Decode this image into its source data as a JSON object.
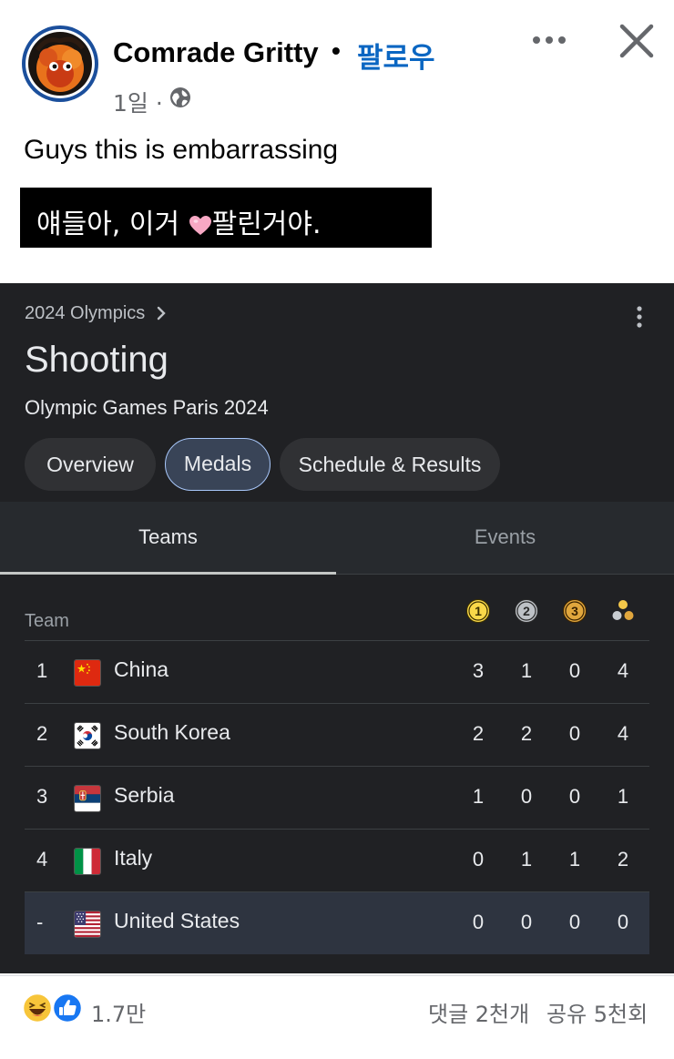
{
  "post": {
    "author": "Comrade Gritty",
    "separator": "•",
    "follow_label": "팔로우",
    "time": "1일 ·",
    "privacy_icon": "globe-icon",
    "text": "Guys this is embarrassing",
    "translation_before": "얘들아, 이거 ",
    "translation_after": "팔린거야.",
    "translation_emoji": "pink-heart-icon"
  },
  "card": {
    "breadcrumb": "2024 Olympics",
    "title": "Shooting",
    "subtitle": "Olympic Games Paris 2024",
    "chips": [
      {
        "label": "Overview",
        "active": false
      },
      {
        "label": "Medals",
        "active": true
      },
      {
        "label": "Schedule & Results",
        "active": false
      }
    ],
    "tabs": [
      {
        "label": "Teams",
        "selected": true
      },
      {
        "label": "Events",
        "selected": false
      }
    ],
    "table": {
      "team_header": "Team",
      "medal_headers": [
        {
          "icon": "gold-medal-icon",
          "label": "1",
          "color": "#f9d849"
        },
        {
          "icon": "silver-medal-icon",
          "label": "2",
          "color": "#bdc1c6"
        },
        {
          "icon": "bronze-medal-icon",
          "label": "3",
          "color": "#e0a63d"
        },
        {
          "icon": "total-medals-icon",
          "color": "#f4c84a"
        }
      ],
      "rows": [
        {
          "rank": "1",
          "team": "China",
          "flag": "china-flag-icon",
          "gold": "3",
          "silver": "1",
          "bronze": "0",
          "total": "4"
        },
        {
          "rank": "2",
          "team": "South Korea",
          "flag": "south-korea-flag-icon",
          "gold": "2",
          "silver": "2",
          "bronze": "0",
          "total": "4"
        },
        {
          "rank": "3",
          "team": "Serbia",
          "flag": "serbia-flag-icon",
          "gold": "1",
          "silver": "0",
          "bronze": "0",
          "total": "1"
        },
        {
          "rank": "4",
          "team": "Italy",
          "flag": "italy-flag-icon",
          "gold": "0",
          "silver": "1",
          "bronze": "1",
          "total": "2"
        },
        {
          "rank": "-",
          "team": "United States",
          "flag": "united-states-flag-icon",
          "gold": "0",
          "silver": "0",
          "bronze": "0",
          "total": "0",
          "highlighted": true
        }
      ]
    }
  },
  "footer": {
    "reactions": [
      "haha-reaction-icon",
      "like-reaction-icon"
    ],
    "reaction_count": "1.7만",
    "comments": "댓글 2천개",
    "shares": "공유 5천회"
  },
  "colors": {
    "follow_blue": "#0a66c2",
    "card_bg": "#202124",
    "active_chip_border": "#a8c7fa",
    "highlight_row": "#2e3440"
  }
}
